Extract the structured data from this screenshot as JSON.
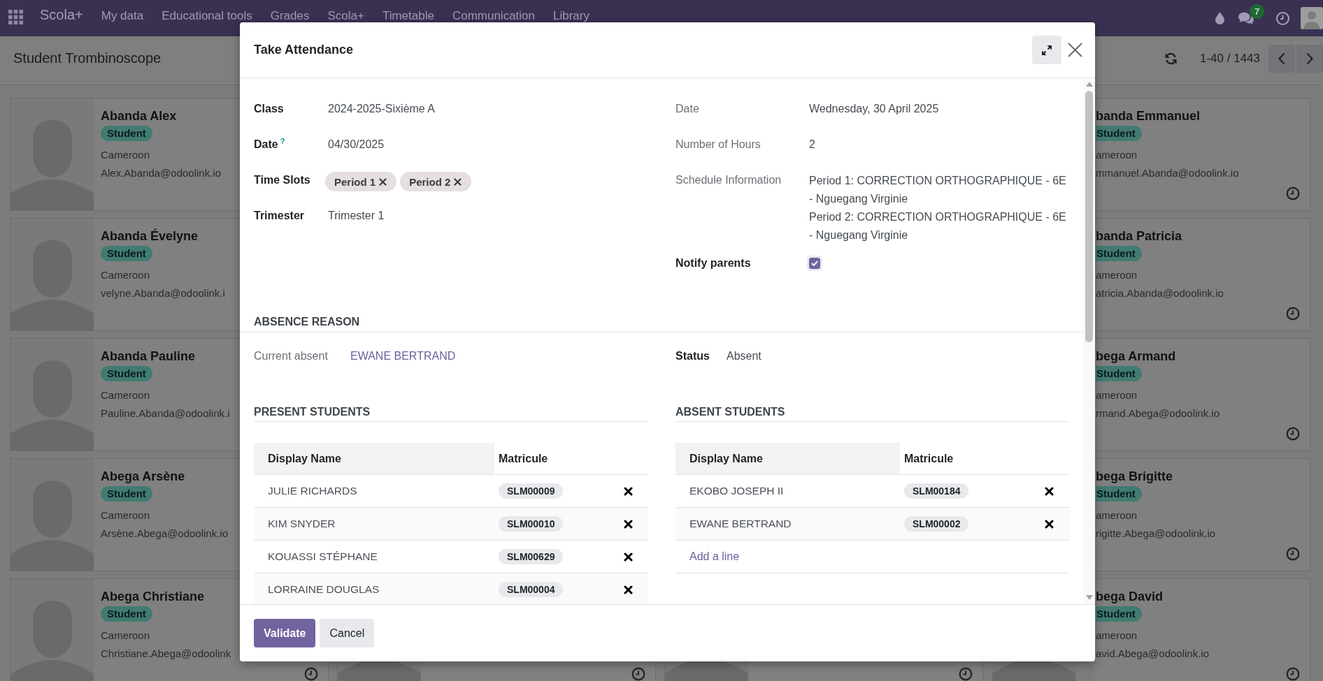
{
  "navbar": {
    "brand": "Scola+",
    "menu": [
      "My data",
      "Educational tools",
      "Grades",
      "Scola+",
      "Timetable",
      "Communication",
      "Library"
    ],
    "messages_count": "7"
  },
  "control_panel": {
    "title": "Student Trombinoscope",
    "pager": "1-40 / 1443"
  },
  "kanban": {
    "left_cards": [
      {
        "name": "Abanda Alex",
        "tag": "Student",
        "country": "Cameroon",
        "email": "Alex.Abanda@odoolink.io"
      },
      {
        "name": "Abanda Évelyne",
        "tag": "Student",
        "country": "Cameroon",
        "email": "velyne.Abanda@odoolink.i"
      },
      {
        "name": "Abanda Pauline",
        "tag": "Student",
        "country": "Cameroon",
        "email": "Pauline.Abanda@odoolink.i"
      },
      {
        "name": "Abega Arsène",
        "tag": "Student",
        "country": "Cameroon",
        "email": "Arsène.Abega@odoolink.io"
      },
      {
        "name": "Abega Christiane",
        "tag": "Student",
        "country": "Cameroon",
        "email": "Christiane.Abega@odoolink"
      }
    ],
    "right_cards": [
      {
        "name": "banda Emmanuel",
        "tag": "Student",
        "country": "ameroon",
        "email": "mmanuel.Abanda@odoolink.io"
      },
      {
        "name": "banda Patricia",
        "tag": "Student",
        "country": "ameroon",
        "email": "atricia.Abanda@odoolink.io"
      },
      {
        "name": "bega Armand",
        "tag": "Student",
        "country": "ameroon",
        "email": "rmand.Abega@odoolink.io"
      },
      {
        "name": "bega Brigitte",
        "tag": "Student",
        "country": "ameroon",
        "email": "rigitte.Abega@odoolink.io"
      },
      {
        "name": "bega David",
        "tag": "Student",
        "country": "ameroon",
        "email": "avid.Abega@odoolink.io"
      }
    ]
  },
  "dialog": {
    "title": "Take Attendance",
    "fields_left": [
      {
        "kind": "text",
        "label": "Class",
        "readonly": false,
        "value": "2024-2025-Sixième A"
      },
      {
        "kind": "text",
        "label": "Date$^{?}$",
        "readonly": false,
        "value": "04/30/2025"
      },
      {
        "kind": "tags",
        "label": "Time Slots",
        "readonly": false,
        "tags": [
          "Period 1",
          "Period 2"
        ]
      },
      {
        "kind": "text",
        "label": "Trimester",
        "readonly": false,
        "value": "Trimester 1"
      }
    ],
    "fields_right": [
      {
        "kind": "text",
        "label": "Date",
        "readonly": true,
        "value": "Wednesday, 30 April 2025"
      },
      {
        "kind": "text",
        "label": "Number of Hours",
        "readonly": true,
        "value": "2"
      },
      {
        "kind": "lines",
        "label": "Schedule Information",
        "readonly": true,
        "lines": [
          "Period 1: CORRECTION ORTHOGRAPHIQUE - 6E - Nguegang Virginie",
          "Period 2: CORRECTION ORTHOGRAPHIQUE - 6E - Nguegang Virginie"
        ]
      },
      {
        "kind": "checkbox",
        "label": "Notify parents",
        "readonly": false,
        "checked": true
      }
    ],
    "absence_reason": {
      "title": "ABSENCE REASON",
      "fields": [
        {
          "kind": "link",
          "label": "Current absent",
          "readonly": true,
          "value": "EWANE BERTRAND"
        },
        {
          "kind": "text",
          "label": "Status",
          "readonly": false,
          "value": "Absent"
        }
      ]
    },
    "present_students": {
      "title": "PRESENT STUDENTS",
      "columns": [
        "Display Name",
        "Matricule"
      ],
      "rows": [
        {
          "name": "JULIE RICHARDS",
          "matricule": "SLM00009"
        },
        {
          "name": "KIM SNYDER",
          "matricule": "SLM00010"
        },
        {
          "name": "KOUASSI STÉPHANE",
          "matricule": "SLM00629"
        },
        {
          "name": "LORRAINE DOUGLAS",
          "matricule": "SLM00004"
        }
      ]
    },
    "absent_students": {
      "title": "ABSENT STUDENTS",
      "columns": [
        "Display Name",
        "Matricule"
      ],
      "rows": [
        {
          "name": "EKOBO JOSEPH II",
          "matricule": "SLM00184"
        },
        {
          "name": "EWANE BERTRAND",
          "matricule": "SLM00002"
        }
      ],
      "add_line": "Add a line"
    },
    "buttons": [
      {
        "kind": "validate",
        "label": "Validate"
      },
      {
        "kind": "cancel",
        "label": "Cancel"
      }
    ]
  }
}
